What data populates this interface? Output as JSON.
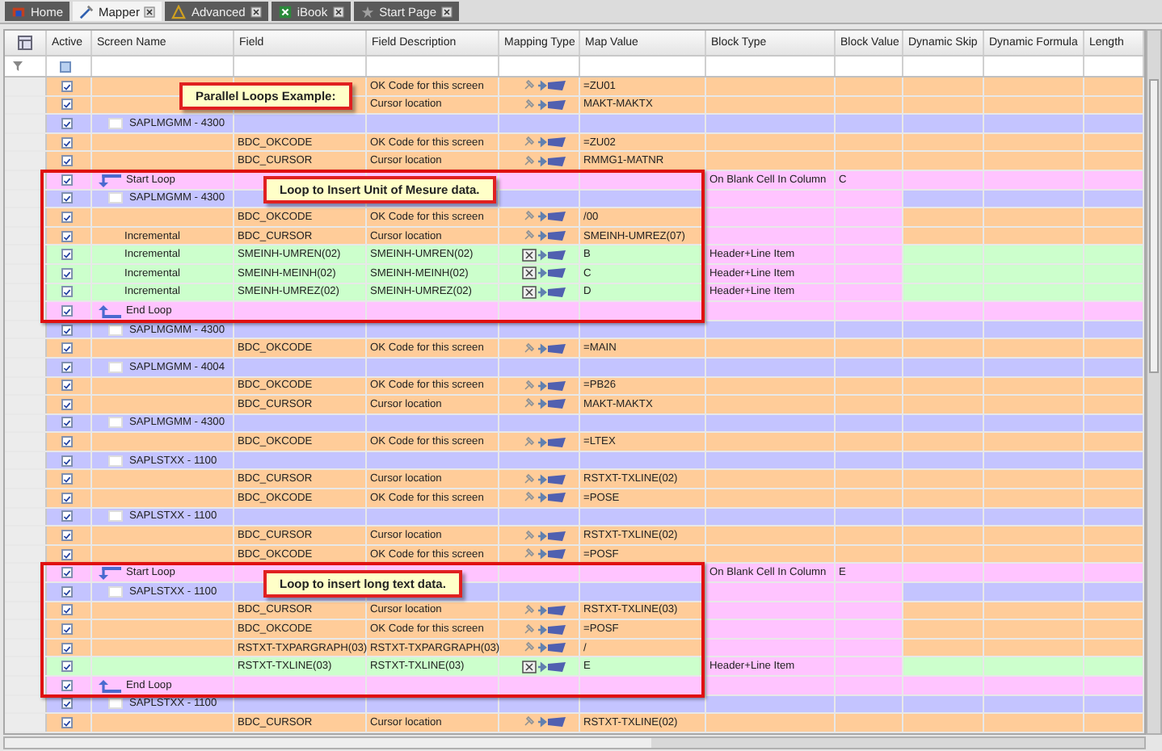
{
  "tabs": [
    {
      "label": "Home",
      "selected": false,
      "closable": false
    },
    {
      "label": "Mapper",
      "selected": true,
      "closable": true
    },
    {
      "label": "Advanced",
      "selected": false,
      "closable": true
    },
    {
      "label": "iBook",
      "selected": false,
      "closable": true
    },
    {
      "label": "Start Page",
      "selected": false,
      "closable": true
    }
  ],
  "table": {
    "columns": [
      "Active",
      "Screen Name",
      "Field",
      "Field Description",
      "Mapping Type",
      "Map Value",
      "Block Type",
      "Block Value",
      "Dynamic Skip",
      "Dynamic Formula",
      "Length"
    ],
    "rows": [
      {
        "kind": "field",
        "active": true,
        "description": "OK Code for this screen",
        "mapping": {
          "kind": "fixed"
        },
        "map_value": "=ZU01",
        "callout": "Parallel Loops Example:"
      },
      {
        "kind": "field",
        "active": true,
        "description": "Cursor location",
        "mapping": {
          "kind": "fixed"
        },
        "map_value": "MAKT-MAKTX"
      },
      {
        "kind": "screen",
        "active": true,
        "label": "SAPLMGMM - 4300"
      },
      {
        "kind": "field",
        "active": true,
        "field": "BDC_OKCODE",
        "description": "OK Code for this screen",
        "mapping": {
          "kind": "fixed"
        },
        "map_value": "=ZU02"
      },
      {
        "kind": "field",
        "active": true,
        "field": "BDC_CURSOR",
        "description": "Cursor location",
        "mapping": {
          "kind": "fixed"
        },
        "map_value": "RMMG1-MATNR"
      },
      {
        "kind": "start_loop",
        "active": true,
        "label": "Start Loop",
        "block_type": "On Blank Cell In Column",
        "block_value": "C",
        "callout": "Loop to Insert Unit of Mesure data."
      },
      {
        "kind": "screen",
        "active": true,
        "label": "SAPLMGMM - 4300"
      },
      {
        "kind": "field",
        "active": true,
        "field": "BDC_OKCODE",
        "description": "OK Code for this screen",
        "mapping": {
          "kind": "fixed"
        },
        "map_value": "/00"
      },
      {
        "kind": "field",
        "active": true,
        "label": "Incremental",
        "field": "BDC_CURSOR",
        "description": "Cursor location",
        "mapping": {
          "kind": "fixed"
        },
        "map_value": "SMEINH-UMREZ(07)"
      },
      {
        "kind": "field",
        "active": true,
        "label": "Incremental",
        "field": "SMEINH-UMREN(02)",
        "description": "SMEINH-UMREN(02)",
        "mapping": {
          "kind": "sheet"
        },
        "map_value": "B",
        "block_type": "Header+Line Item"
      },
      {
        "kind": "field",
        "active": true,
        "label": "Incremental",
        "field": "SMEINH-MEINH(02)",
        "description": "SMEINH-MEINH(02)",
        "mapping": {
          "kind": "sheet"
        },
        "map_value": "C",
        "block_type": "Header+Line Item"
      },
      {
        "kind": "field",
        "active": true,
        "label": "Incremental",
        "field": "SMEINH-UMREZ(02)",
        "description": "SMEINH-UMREZ(02)",
        "mapping": {
          "kind": "sheet"
        },
        "map_value": "D",
        "block_type": "Header+Line Item"
      },
      {
        "kind": "end_loop",
        "active": true,
        "label": "End Loop"
      },
      {
        "kind": "screen",
        "active": true,
        "label": "SAPLMGMM - 4300"
      },
      {
        "kind": "field",
        "active": true,
        "field": "BDC_OKCODE",
        "description": "OK Code for this screen",
        "mapping": {
          "kind": "fixed"
        },
        "map_value": "=MAIN"
      },
      {
        "kind": "screen",
        "active": true,
        "label": "SAPLMGMM - 4004"
      },
      {
        "kind": "field",
        "active": true,
        "field": "BDC_OKCODE",
        "description": "OK Code for this screen",
        "mapping": {
          "kind": "fixed"
        },
        "map_value": "=PB26"
      },
      {
        "kind": "field",
        "active": true,
        "field": "BDC_CURSOR",
        "description": "Cursor location",
        "mapping": {
          "kind": "fixed"
        },
        "map_value": "MAKT-MAKTX"
      },
      {
        "kind": "screen",
        "active": true,
        "label": "SAPLMGMM - 4300"
      },
      {
        "kind": "field",
        "active": true,
        "field": "BDC_OKCODE",
        "description": "OK Code for this screen",
        "mapping": {
          "kind": "fixed"
        },
        "map_value": "=LTEX"
      },
      {
        "kind": "screen",
        "active": true,
        "label": "SAPLSTXX - 1100"
      },
      {
        "kind": "field",
        "active": true,
        "field": "BDC_CURSOR",
        "description": "Cursor location",
        "mapping": {
          "kind": "fixed"
        },
        "map_value": "RSTXT-TXLINE(02)"
      },
      {
        "kind": "field",
        "active": true,
        "field": "BDC_OKCODE",
        "description": "OK Code for this screen",
        "mapping": {
          "kind": "fixed"
        },
        "map_value": "=POSE"
      },
      {
        "kind": "screen",
        "active": true,
        "label": "SAPLSTXX - 1100"
      },
      {
        "kind": "field",
        "active": true,
        "field": "BDC_CURSOR",
        "description": "Cursor location",
        "mapping": {
          "kind": "fixed"
        },
        "map_value": "RSTXT-TXLINE(02)"
      },
      {
        "kind": "field",
        "active": true,
        "field": "BDC_OKCODE",
        "description": "OK Code for this screen",
        "mapping": {
          "kind": "fixed"
        },
        "map_value": "=POSF"
      },
      {
        "kind": "start_loop",
        "active": true,
        "label": "Start Loop",
        "block_type": "On Blank Cell In Column",
        "block_value": "E",
        "callout": "Loop to insert long text data."
      },
      {
        "kind": "screen",
        "active": true,
        "label": "SAPLSTXX - 1100"
      },
      {
        "kind": "field",
        "active": true,
        "field": "BDC_CURSOR",
        "description": "Cursor location",
        "mapping": {
          "kind": "fixed"
        },
        "map_value": "RSTXT-TXLINE(03)"
      },
      {
        "kind": "field",
        "active": true,
        "field": "BDC_OKCODE",
        "description": "OK Code for this screen",
        "mapping": {
          "kind": "fixed"
        },
        "map_value": "=POSF"
      },
      {
        "kind": "field",
        "active": true,
        "field": "RSTXT-TXPARGRAPH(03)",
        "description": "RSTXT-TXPARGRAPH(03)",
        "mapping": {
          "kind": "fixed"
        },
        "map_value": "/"
      },
      {
        "kind": "field",
        "active": true,
        "field": "RSTXT-TXLINE(03)",
        "description": "RSTXT-TXLINE(03)",
        "mapping": {
          "kind": "sheet"
        },
        "map_value": "E",
        "block_type": "Header+Line Item"
      },
      {
        "kind": "end_loop",
        "active": true,
        "label": "End Loop"
      },
      {
        "kind": "screen",
        "active": true,
        "label": "SAPLSTXX - 1100"
      },
      {
        "kind": "field",
        "active": true,
        "field": "BDC_CURSOR",
        "description": "Cursor location",
        "mapping": {
          "kind": "fixed"
        },
        "map_value": "RSTXT-TXLINE(02)"
      }
    ]
  }
}
